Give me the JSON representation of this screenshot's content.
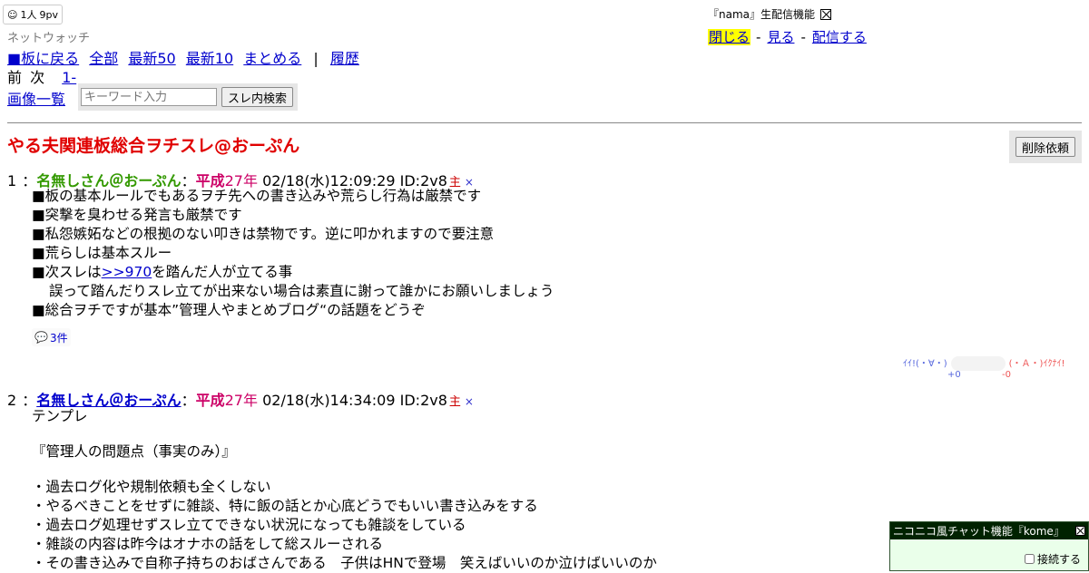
{
  "counter": {
    "users": "1人",
    "pv": "9pv"
  },
  "site_name": "ネットウォッチ",
  "nav": {
    "back": "■板に戻る",
    "all": "全部",
    "latest50": "最新50",
    "latest10": "最新10",
    "summary": "まとめる",
    "separator": "|",
    "history": "履歴"
  },
  "pager": {
    "prev": "前",
    "next": "次",
    "range": "1-"
  },
  "image_list": "画像一覧",
  "search": {
    "placeholder": "キーワード入力",
    "button": "スレ内検索"
  },
  "nama": {
    "title": "『nama』生配信機能",
    "close": "閉じる",
    "watch": "見る",
    "broadcast": "配信する",
    "dash": "-"
  },
  "thread": {
    "title": "やる夫関連板総合ヲチスレ@おーぷん",
    "delete_request": "削除依頼"
  },
  "posts": [
    {
      "num": "1",
      "sep": "：",
      "name": "名無しさん＠おーぷん",
      "colon": "：",
      "era": "平成",
      "year": "27年",
      "datetime": "02/18(水)12:09:29",
      "id": "ID:2v8",
      "owner": "主",
      "x": "×",
      "lines": [
        "■板の基本ルールでもあるヲチ先への書き込みや荒らし行為は厳禁です",
        "■突撃を臭わせる発言も厳禁です",
        "■私怨嫉妬などの根拠のない叩きは禁物です。逆に叩かれますので要注意",
        "■荒らしは基本スルー",
        "■次スレは",
        "を踏んだ人が立てる事",
        "誤って踏んだりスレ立てが出来ない場合は素直に謝って誰かにお願いしましょう",
        "■総合ヲチですが基本”管理人やまとめブログ“の話題をどうぞ"
      ],
      "anchor": ">>970",
      "reply_count": "3件",
      "vote": {
        "good_label": "ｲｲ!(・∀・)",
        "bad_label": "(・Ａ・)ｲｸﾅｲ!",
        "good": "+0",
        "bad": "-0"
      }
    },
    {
      "num": "2",
      "sep": "：",
      "name": "名無しさん＠おーぷん",
      "colon": "：",
      "era": "平成",
      "year": "27年",
      "datetime": "02/18(水)14:34:09",
      "id": "ID:2v8",
      "owner": "主",
      "x": "×",
      "lines": [
        "テンプレ",
        "『管理人の問題点（事実のみ）』",
        "・過去ログ化や規制依頼も全くしない",
        "・やるべきことをせずに雑談、特に飯の話とか心底どうでもいい書き込みをする",
        "・過去ログ処理せずスレ立てできない状況になっても雑談をしている",
        "・雑談の内容は昨今はオナホの話をして総スルーされる",
        "・その書き込みで自称子持ちのおばさんである　子供はHNで登場　笑えばいいのか泣けばいいのか"
      ]
    }
  ],
  "chat": {
    "title": "ニコニコ風チャット機能『kome』",
    "connect": "接続する"
  }
}
